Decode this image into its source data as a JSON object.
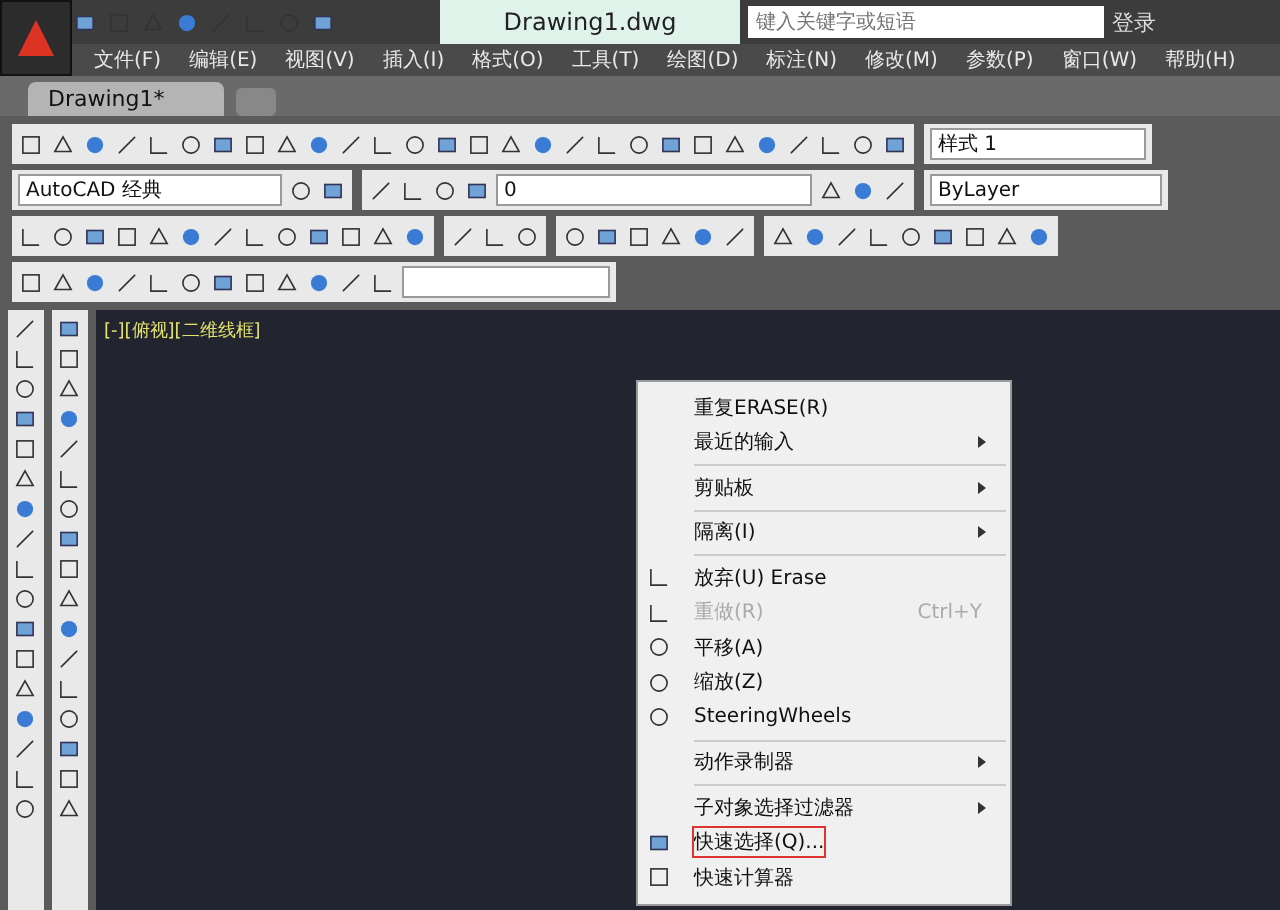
{
  "title_bar": {
    "title": "Drawing1.dwg",
    "search": {
      "placeholder": "键入关键字或短语"
    },
    "sign_in": "登录"
  },
  "menu_bar": [
    "文件(F)",
    "编辑(E)",
    "视图(V)",
    "插入(I)",
    "格式(O)",
    "工具(T)",
    "绘图(D)",
    "标注(N)",
    "修改(M)",
    "参数(P)",
    "窗口(W)",
    "帮助(H)"
  ],
  "tabs": [
    {
      "label": "Drawing1*",
      "selected": true
    }
  ],
  "toolbars": {
    "text_style": "样式 1",
    "workspace": "AutoCAD 经典",
    "layer": "0",
    "color_control": "ByLayer"
  },
  "viewport": {
    "label": "[-][俯视][二维线框]"
  },
  "context_menu": [
    {
      "kind": "item",
      "label": "重复ERASE(R)",
      "submenu": false,
      "disabled": false,
      "highlighted": false
    },
    {
      "kind": "item",
      "label": "最近的输入",
      "submenu": true,
      "disabled": false,
      "highlighted": false
    },
    {
      "kind": "separator"
    },
    {
      "kind": "item",
      "label": "剪贴板",
      "submenu": true,
      "disabled": false,
      "highlighted": false
    },
    {
      "kind": "separator"
    },
    {
      "kind": "item",
      "label": "隔离(I)",
      "submenu": true,
      "disabled": false,
      "highlighted": false
    },
    {
      "kind": "separator"
    },
    {
      "kind": "item",
      "label": "放弃(U) Erase",
      "submenu": false,
      "disabled": false,
      "highlighted": false
    },
    {
      "kind": "item",
      "label": "重做(R)",
      "shortcut": "Ctrl+Y",
      "submenu": false,
      "disabled": true,
      "highlighted": false
    },
    {
      "kind": "item",
      "label": "平移(A)",
      "submenu": false,
      "disabled": false,
      "highlighted": false
    },
    {
      "kind": "item",
      "label": "缩放(Z)",
      "submenu": false,
      "disabled": false,
      "highlighted": false
    },
    {
      "kind": "item",
      "label": "SteeringWheels",
      "submenu": false,
      "disabled": false,
      "highlighted": false
    },
    {
      "kind": "separator"
    },
    {
      "kind": "item",
      "label": "动作录制器",
      "submenu": true,
      "disabled": false,
      "highlighted": false
    },
    {
      "kind": "separator"
    },
    {
      "kind": "item",
      "label": "子对象选择过滤器",
      "submenu": true,
      "disabled": false,
      "highlighted": false
    },
    {
      "kind": "item",
      "label": "快速选择(Q)...",
      "submenu": false,
      "disabled": false,
      "highlighted": true
    },
    {
      "kind": "item",
      "label": "快速计算器",
      "submenu": false,
      "disabled": false,
      "highlighted": false
    }
  ]
}
